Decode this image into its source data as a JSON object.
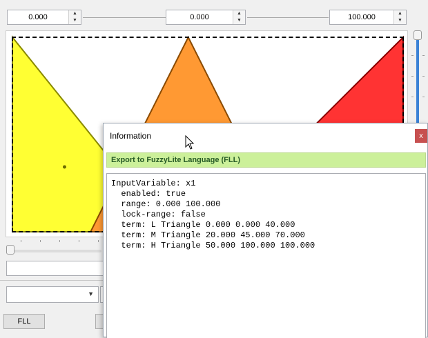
{
  "range": {
    "minimum": "0.000",
    "value": "0.000",
    "maximum": "100.000"
  },
  "icons": {
    "spin_up": "spin-up-arrow",
    "spin_down": "spin-down-arrow",
    "combo_arrow": "dropdown-arrow",
    "close": "close-icon",
    "cursor": "mouse-pointer"
  },
  "terms_chart": {
    "universe": [
      0,
      100
    ],
    "terms": [
      {
        "name": "L",
        "points": [
          0,
          0,
          40
        ],
        "fill": "#ffff33",
        "stroke": "#8a8a00"
      },
      {
        "name": "M",
        "points": [
          20,
          45,
          70
        ],
        "fill": "#ff9933",
        "stroke": "#8a4a00"
      },
      {
        "name": "H",
        "points": [
          50,
          100,
          100
        ],
        "fill": "#ff3333",
        "stroke": "#8a0000"
      }
    ]
  },
  "buttons": {
    "fll": "FLL"
  },
  "dialog": {
    "title": "Information",
    "close_label": "x",
    "header": "Export to FuzzyLite Language (FLL)",
    "code_lines": [
      "InputVariable: x1",
      "  enabled: true",
      "  range: 0.000 100.000",
      "  lock-range: false",
      "  term: L Triangle 0.000 0.000 40.000",
      "  term: M Triangle 20.000 45.000 70.000",
      "  term: H Triangle 50.000 100.000 100.000"
    ]
  }
}
